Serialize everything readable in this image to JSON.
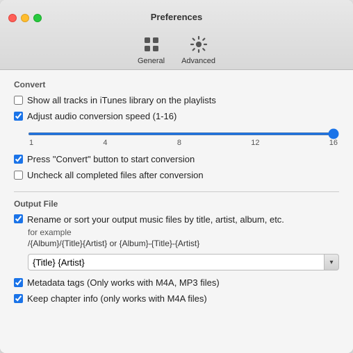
{
  "window": {
    "title": "Preferences"
  },
  "toolbar": {
    "items": [
      {
        "id": "general",
        "label": "General",
        "icon": "general-icon"
      },
      {
        "id": "advanced",
        "label": "Advanced",
        "icon": "gear-icon"
      }
    ]
  },
  "convert_section": {
    "label": "Convert",
    "checkboxes": [
      {
        "id": "show-all-tracks",
        "label": "Show all tracks in iTunes library on the playlists",
        "checked": false
      },
      {
        "id": "adjust-audio-speed",
        "label": "Adjust audio conversion speed (1-16)",
        "checked": true
      },
      {
        "id": "press-convert",
        "label": "Press \"Convert\" button to start conversion",
        "checked": true
      },
      {
        "id": "uncheck-completed",
        "label": "Uncheck all completed files after conversion",
        "checked": false
      }
    ],
    "slider": {
      "min": 1,
      "max": 16,
      "value": 16,
      "labels": [
        "1",
        "4",
        "8",
        "12",
        "16"
      ]
    }
  },
  "output_section": {
    "label": "Output File",
    "rename_checkbox": {
      "id": "rename-sort",
      "label": "Rename or sort your output music files by title, artist, album, etc.",
      "checked": true
    },
    "for_example_label": "for example",
    "example_path": "/{Album}/{Title}{Artist} or {Album}-{Title}-{Artist}",
    "input_value": "{Title} {Artist}",
    "metadata_checkbox": {
      "id": "metadata-tags",
      "label": "Metadata tags (Only works with M4A, MP3 files)",
      "checked": true
    },
    "chapter_checkbox": {
      "id": "keep-chapter",
      "label": "Keep chapter info (only works with  M4A files)",
      "checked": true
    }
  },
  "icons": {
    "chevron_down": "▾",
    "checkmark": "✓"
  }
}
